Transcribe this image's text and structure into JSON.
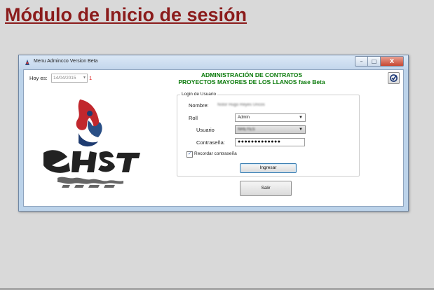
{
  "slide": {
    "title": "Módulo de Inicio de sesión"
  },
  "window": {
    "title": "Menu Admincco Version Beta",
    "buttons": {
      "minimize": "–",
      "maximize": "□",
      "close": "X"
    }
  },
  "header": {
    "hoy_label": "Hoy es:",
    "date_value": "14/04/2015",
    "counter": "1",
    "heading_line1": "ADMINISTRACIÓN DE CONTRATOS",
    "heading_line2": "PROYECTOS MAYORES DE LOS LLANOS fase Beta"
  },
  "login": {
    "group_title": "Login de Usuario",
    "nombre_label": "Nombre:",
    "nombre_value": "Nstor Hugo Reyes Uncos",
    "roll_label": "Roll",
    "roll_value": "Admin",
    "usuario_label": "Usuario",
    "usuario_value": "NREYES",
    "contrasena_label": "Contraseña:",
    "contrasena_value": "●●●●●●●●●●●●●",
    "recordar_label": "Recordar contraseña",
    "recordar_checked": "✓",
    "ingresar_label": "Ingresar"
  },
  "actions": {
    "salir_label": "Salir"
  },
  "icons": {
    "app": "app-logo-icon",
    "refresh": "check-refresh-icon",
    "dropdown": "chevron-down-icon"
  },
  "colors": {
    "title": "#8b1c1c",
    "heading": "#0a7a0a",
    "counter": "#dd1111",
    "accent": "#3c7fb1"
  }
}
